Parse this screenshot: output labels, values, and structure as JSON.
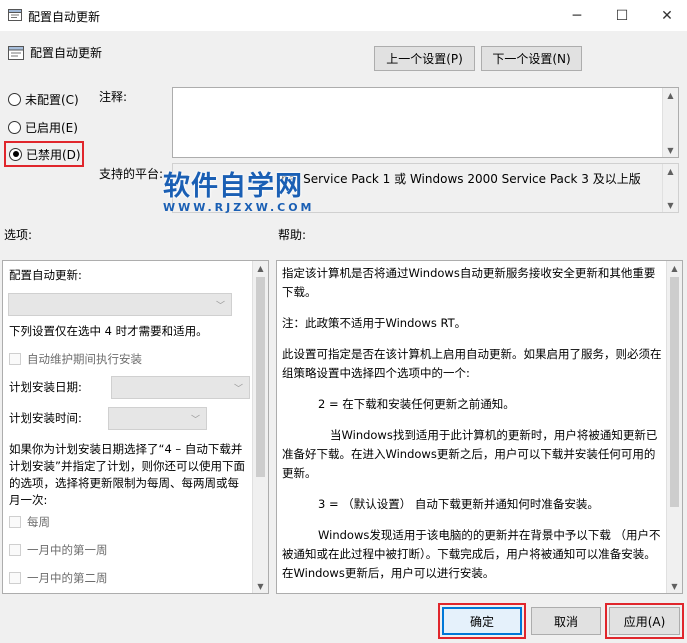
{
  "window": {
    "title": "配置自动更新",
    "minimize": "─",
    "maximize": "☐",
    "close": "✕"
  },
  "header": {
    "policy_title": "配置自动更新",
    "prev_button": "上一个设置(P)",
    "next_button": "下一个设置(N)"
  },
  "state": {
    "options": [
      {
        "label": "未配置(C)",
        "checked": false
      },
      {
        "label": "已启用(E)",
        "checked": false
      },
      {
        "label": "已禁用(D)",
        "checked": true
      }
    ]
  },
  "comment": {
    "label": "注释:",
    "value": ""
  },
  "platform": {
    "label": "支持的平台:",
    "value": "nal Service Pack 1 或 Windows 2000 Service Pack 3 及以上版"
  },
  "watermark": {
    "main": "软件自学网",
    "sub": "WWW.RJZXW.COM"
  },
  "options_panel": {
    "section_label": "选项:",
    "configure_label": "配置自动更新:",
    "note": "下列设置仅在选中 4 时才需要和适用。",
    "auto_maintenance": "自动维护期间执行安装",
    "schedule_day_label": "计划安装日期:",
    "schedule_time_label": "计划安装时间:",
    "paragraph": "如果你为计划安装日期选择了“4 – 自动下载并计划安装”并指定了计划，则你还可以使用下面的选项，选择将更新限制为每周、每两周或每月一次:",
    "every_week": "每周",
    "first_week": "一月中的第一周",
    "second_week": "一月中的第二周"
  },
  "help_panel": {
    "section_label": "帮助:",
    "paragraphs": [
      "指定该计算机是否将通过Windows自动更新服务接收安全更新和其他重要下载。",
      "注：此政策不适用于Windows RT。",
      "此设置可指定是否在该计算机上启用自动更新。如果启用了服务，则必须在组策略设置中选择四个选项中的一个:",
      "2 = 在下载和安装任何更新之前通知。",
      "当Windows找到适用于此计算机的更新时，用户将被通知更新已准备好下载。在进入Windows更新之后，用户可以下载并安装任何可用的更新。",
      "3 = （默认设置） 自动下载更新并通知何时准备安装。",
      "Windows发现适用于该电脑的的更新并在背景中予以下载 （用户不被通知或在此过程中被打断）。下载完成后，用户将被通知可以准备安装。在Windows更新后，用户可以进行安装。"
    ]
  },
  "footer": {
    "ok": "确定",
    "cancel": "取消",
    "apply": "应用(A)"
  },
  "colors": {
    "highlight_red": "#e0262c",
    "focus_blue": "#0078d7",
    "watermark_blue": "#1a5fb4"
  }
}
